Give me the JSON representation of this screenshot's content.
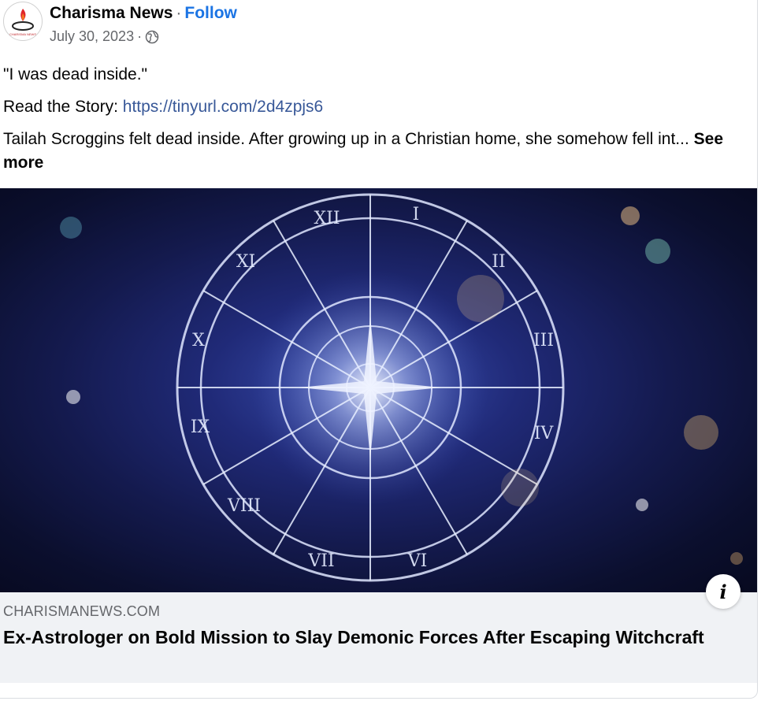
{
  "post": {
    "page_name": "Charisma News",
    "separator": "·",
    "follow_label": "Follow",
    "date": "July 30, 2023",
    "date_separator": "·",
    "audience_icon": "globe-icon",
    "avatar_icon": "charisma-news-logo",
    "quote": "\"I was dead inside.\"",
    "read_prefix": "Read the Story:",
    "story_url": "https://tinyurl.com/2d4zpjs6",
    "body_truncated": "Tailah Scroggins felt dead inside. After growing up in a Christian home, she somehow fell int...",
    "see_more_label": "See more"
  },
  "link_preview": {
    "image_icon": "zodiac-wheel-image",
    "domain": "CHARISMANEWS.COM",
    "headline": "Ex-Astrologer on Bold Mission to Slay Demonic Forces After Escaping Witchcraft",
    "info_icon": "info-icon",
    "info_glyph": "i"
  },
  "colors": {
    "link_blue": "#1b74e4",
    "story_link": "#385898",
    "secondary_text": "#65676b",
    "preview_bg": "#f0f2f5"
  }
}
